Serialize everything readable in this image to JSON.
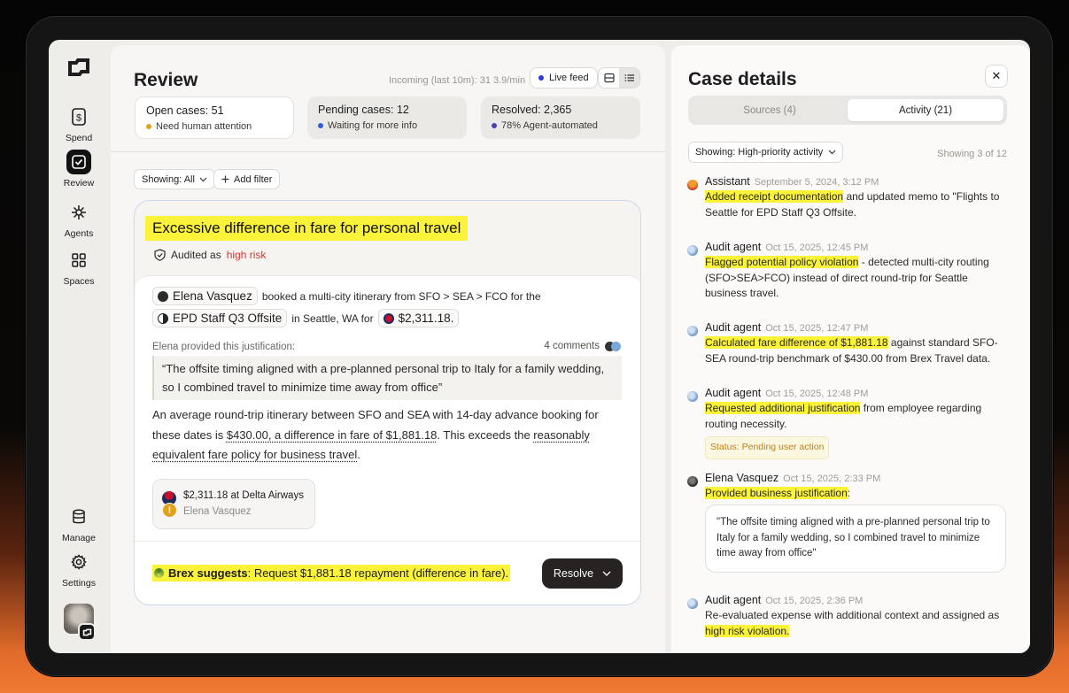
{
  "sidebar": {
    "items": [
      {
        "label": "Spend",
        "icon": "dollar-icon"
      },
      {
        "label": "Review",
        "icon": "check-square-icon"
      },
      {
        "label": "Agents",
        "icon": "sparkle-icon"
      },
      {
        "label": "Spaces",
        "icon": "grid-icon"
      },
      {
        "label": "Manage",
        "icon": "database-icon"
      },
      {
        "label": "Settings",
        "icon": "gear-icon"
      }
    ]
  },
  "review": {
    "title": "Review",
    "incoming": "Incoming (last 10m): 31 3.9/min",
    "live_feed": "Live feed",
    "stats": [
      {
        "title": "Open cases: 51",
        "sub": "Need human attention",
        "dot_color": "#e0a11b"
      },
      {
        "title": "Pending cases: 12",
        "sub": "Waiting for more info",
        "dot_color": "#2f5fd8"
      },
      {
        "title": "Resolved: 2,365",
        "sub": "78% Agent-automated",
        "dot_color": "#4a3fb8"
      }
    ],
    "filter_showing": "Showing: All",
    "add_filter": "Add filter"
  },
  "case": {
    "title": "Excessive difference in fare for personal travel",
    "audited_prefix": "Audited as",
    "risk": "high risk",
    "employee": "Elena Vasquez",
    "booked_text": "booked a multi-city itinerary from SFO > SEA > FCO for the",
    "event": "EPD Staff Q3 Offsite",
    "location_text": "in Seattle, WA for",
    "amount": "$2,311.18.",
    "justification_label": "Elena provided this justification:",
    "comments": "4 comments",
    "quote": "“The offsite timing aligned with a pre-planned personal trip to Italy for a family wedding, so I combined travel to minimize time away from office”",
    "para_1": "An average round-trip itinerary between SFO and SEA with 14-day advance booking for these dates is",
    "para_link_1": "$430.00, a difference in fare of $1,881.18",
    "para_2": ". This exceeds the",
    "para_link_2": "reasonably equivalent fare policy for business travel",
    "para_3": ".",
    "receipt_amount": "$2,311.18 at Delta Airways",
    "receipt_user": "Elena Vasquez",
    "suggest_label": "Brex suggests",
    "suggest_text": ": Request $1,881.18 repayment (difference in fare).",
    "resolve": "Resolve"
  },
  "details": {
    "title": "Case details",
    "tabs": [
      {
        "label": "Sources (4)"
      },
      {
        "label": "Activity (21)"
      }
    ],
    "filter": "Showing: High-priority activity",
    "count": "Showing 3 of 12",
    "entries": [
      {
        "who": "Assistant",
        "time": "September 5, 2024, 3:12 PM",
        "hl": "Added receipt documentation",
        "rest": " and updated memo to \"Flights to Seattle for EPD Staff Q3 Offsite."
      },
      {
        "who": "Audit agent",
        "time": "Oct 15, 2025, 12:45 PM",
        "hl": "Flagged potential policy violation",
        "rest": " - detected multi-city routing (SFO>SEA>FCO) instead of direct round-trip for Seattle business travel."
      },
      {
        "who": "Audit agent",
        "time": "Oct 15, 2025, 12:47 PM",
        "hl": "Calculated fare difference of $1,881.18",
        "rest": " against standard SFO-SEA round-trip benchmark of $430.00 from Brex Travel data."
      },
      {
        "who": "Audit agent",
        "time": "Oct 15, 2025, 12:48 PM",
        "hl": "Requested additional justification",
        "rest": " from employee regarding routing necessity.",
        "status": "Status: Pending user action"
      },
      {
        "who": "Elena Vasquez",
        "time": "Oct 15, 2025, 2:33 PM",
        "hl": "Provided business justification",
        "rest": ":",
        "reply": "\"The offsite timing aligned with a pre-planned personal trip to Italy for a family wedding, so I combined travel to minimize time away from office\""
      },
      {
        "who": "Audit agent",
        "time": "Oct 15, 2025, 2:36 PM",
        "rest_pre": "Re-evaluated expense with additional context and assigned as ",
        "hl": "high risk violation."
      }
    ]
  },
  "colors": {
    "highlight": "#fbf23a",
    "risk": "#e1322b",
    "card_border": "#c9d8ef",
    "live_dot": "#2a3fd0"
  }
}
